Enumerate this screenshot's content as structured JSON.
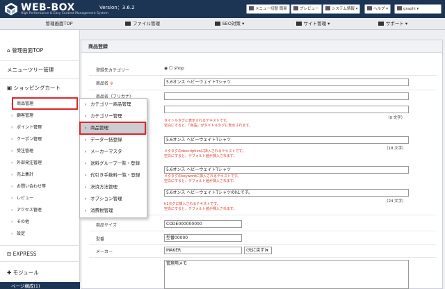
{
  "header": {
    "logo": "WEB-BOX",
    "logo_sub": "High Performance & Easy Content Management System",
    "version": "Version：3.6.2",
    "buttons": [
      {
        "label": "メニュー切替 簡易"
      },
      {
        "label": "プレビュー"
      },
      {
        "label": "システム情報"
      },
      {
        "label": "ヘルプ"
      },
      {
        "label": "graphi"
      }
    ]
  },
  "nav": {
    "items": [
      {
        "label": "管理画面TOP",
        "icon": "home-icon"
      },
      {
        "label": "ファイル管理",
        "icon": "image-icon"
      },
      {
        "label": "SEO対策",
        "icon": "chart-icon"
      },
      {
        "label": "サイト管理",
        "icon": "flag-icon"
      },
      {
        "label": "サポート",
        "icon": "support-icon"
      }
    ]
  },
  "sidebar": {
    "top": "管理画面TOP",
    "menutree": "メニューツリー管理",
    "shopping": "ショッピングカート",
    "items": [
      "商品管理",
      "顧客管理",
      "ポイント管理",
      "クーポン管理",
      "受注管理",
      "外部発注管理",
      "売上集計",
      "お問い合わせ等",
      "レビュー",
      "アクセス管理",
      "その他",
      "設定"
    ],
    "express": "EXPRESS",
    "module": "モジュール",
    "page": "ページ構成(1)"
  },
  "flyout": {
    "items": [
      "カテゴリー商品管理",
      "カテゴリー管理",
      "商品管理",
      "データ一括登録",
      "メーカーマスタ",
      "送料グループ一覧・登録",
      "代引き手数料一覧・登録",
      "決済方法管理",
      "オプション管理",
      "消費税管理"
    ]
  },
  "form": {
    "title": "商品登録",
    "category_label": "登録先カテゴリー",
    "category_value": "shop",
    "name_label": "商品名",
    "req": "※",
    "name_value": "5.6オンス ヘビーウェイトTシャツ",
    "kana_label": "商品名（フリガナ）",
    "title_count": "（0 文字）",
    "title_hint1": "タイトルタグに表示されるテキストです。",
    "title_hint2": "空白にすると、「商品」がタイトルタグに表示されます。",
    "kw_value": "5.6オンス ヘビーウェイトTシャツ",
    "kw_count": "（18 文字）",
    "kw_hint1": "メタタグのdescriptionに挿入されるテキストです。",
    "kw_hint2": "空白にすると、デフォルト値が挿入されます。",
    "desc_value": "5.6オンス ヘビーウェイトTシャツ",
    "desc_hint1": "メタタグのkeywordに挿入されるテキストです。",
    "desc_hint2": "空白にすると、デフォルト値が挿入されます。",
    "h1_value": "5.6オンス ヘビーウェイトTシャツのh1です。",
    "h1_count": "（24 文字）",
    "h1_hint1": "h1タグに挿入されるテキストです。",
    "h1_hint2": "空白にすると、デフォルト値が挿入されます。",
    "size_label": "商品サイズ",
    "size_value": "CODE000000000",
    "model_label": "型番",
    "model_value": "型番00000",
    "maker_label": "メーカー",
    "maker_value": "MAKER",
    "maker_select": "(元に戻す)",
    "memo_value": "管理用メモ"
  }
}
